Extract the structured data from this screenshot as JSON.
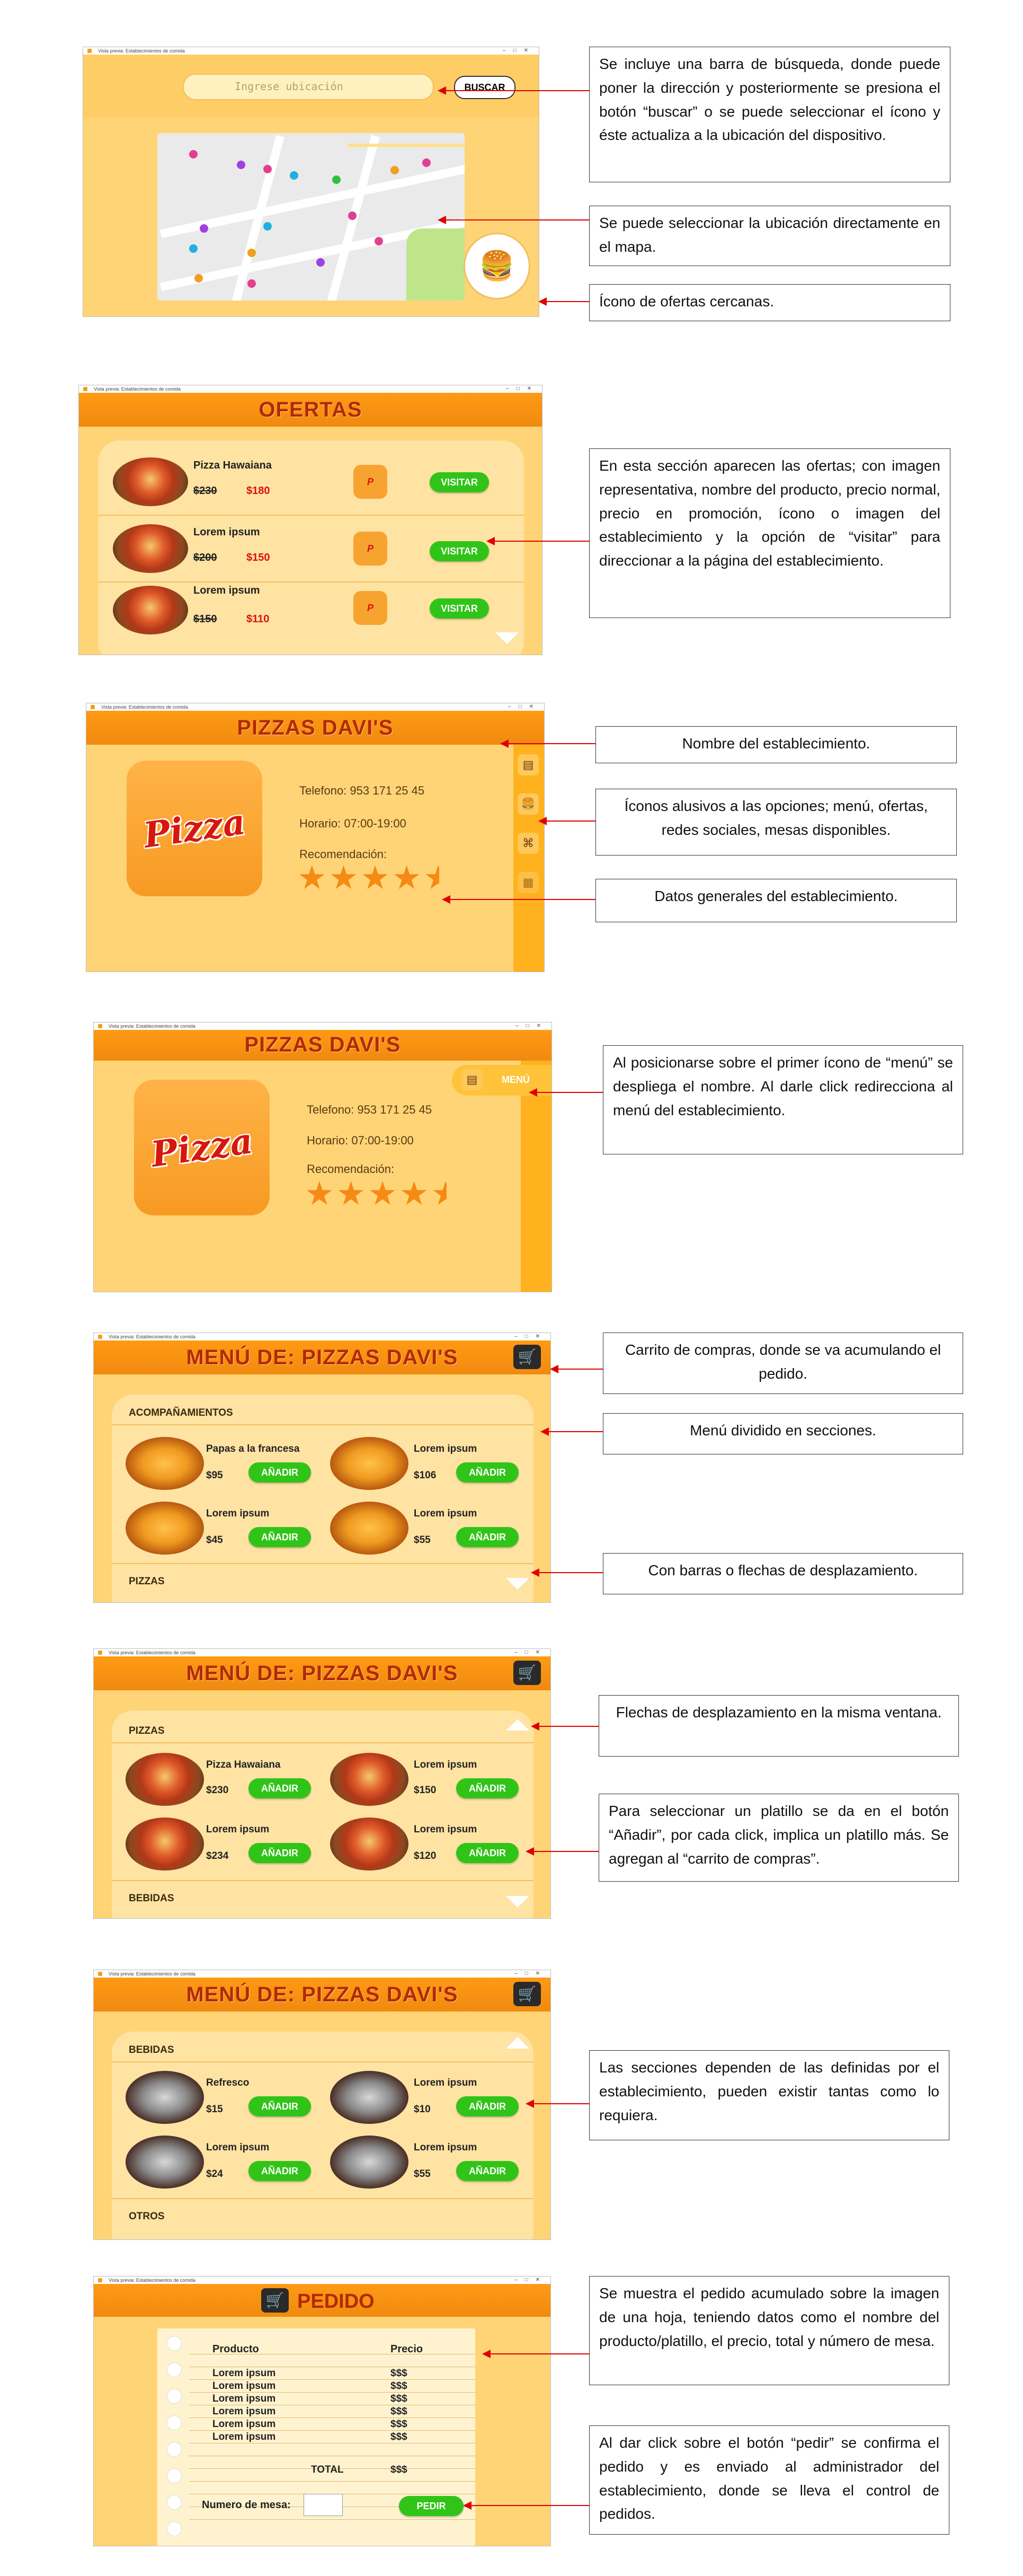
{
  "app_title": "Vista previa: Establecimientos de comida",
  "map_screen": {
    "search_placeholder": "Ingrese ubicación",
    "search_button": "BUSCAR"
  },
  "offers_screen": {
    "title": "OFERTAS",
    "items": [
      {
        "name": "Pizza Hawaiana",
        "old_price": "$230",
        "new_price": "$180",
        "button": "VISITAR"
      },
      {
        "name": "Lorem ipsum",
        "old_price": "$200",
        "new_price": "$150",
        "button": "VISITAR"
      },
      {
        "name": "Lorem ipsum",
        "old_price": "$150",
        "new_price": "$110",
        "button": "VISITAR"
      }
    ]
  },
  "establishment": {
    "name": "PIZZAS DAVI'S",
    "logo_text": "Pizza",
    "phone": "Telefono: 953 171 25 45",
    "hours": "Horario: 07:00-19:00",
    "recommendation_label": "Recomendación:",
    "rating": 4.5,
    "menu_tooltip": "MENÚ"
  },
  "menu_title": "MENÚ DE: PIZZAS DAVI'S",
  "add_label": "AÑADIR",
  "menu_screens": [
    {
      "section": "ACOMPAÑAMIENTOS",
      "next_section": "PIZZAS",
      "items": [
        {
          "name": "Papas a la francesa",
          "price": "$95"
        },
        {
          "name": "Lorem ipsum",
          "price": "$106"
        },
        {
          "name": "Lorem ipsum",
          "price": "$45"
        },
        {
          "name": "Lorem ipsum",
          "price": "$55"
        }
      ]
    },
    {
      "section": "PIZZAS",
      "next_section": "BEBIDAS",
      "items": [
        {
          "name": "Pizza Hawaiana",
          "price": "$230"
        },
        {
          "name": "Lorem ipsum",
          "price": "$150"
        },
        {
          "name": "Lorem ipsum",
          "price": "$234"
        },
        {
          "name": "Lorem ipsum",
          "price": "$120"
        }
      ]
    },
    {
      "section": "BEBIDAS",
      "next_section": "OTROS",
      "items": [
        {
          "name": "Refresco",
          "price": "$15"
        },
        {
          "name": "Lorem ipsum",
          "price": "$10"
        },
        {
          "name": "Lorem ipsum",
          "price": "$24"
        },
        {
          "name": "Lorem ipsum",
          "price": "$55"
        }
      ]
    }
  ],
  "order_screen": {
    "title": "PEDIDO",
    "col_product": "Producto",
    "col_price": "Precio",
    "rows": [
      {
        "product": "Lorem ipsum",
        "price": "$$$"
      },
      {
        "product": "Lorem ipsum",
        "price": "$$$"
      },
      {
        "product": "Lorem ipsum",
        "price": "$$$"
      },
      {
        "product": "Lorem ipsum",
        "price": "$$$"
      },
      {
        "product": "Lorem ipsum",
        "price": "$$$"
      },
      {
        "product": "Lorem ipsum",
        "price": "$$$"
      }
    ],
    "total_label": "TOTAL",
    "total_value": "$$$",
    "table_label": "Numero de mesa:",
    "order_button": "PEDIR"
  },
  "notes": {
    "n1": "Se incluye una barra de búsqueda, donde puede poner la dirección y posteriormente se presiona el botón “buscar” o se puede seleccionar el ícono y éste actualiza a la ubicación del dispositivo.",
    "n2": "Se puede seleccionar la ubicación directamente en el mapa.",
    "n3": "Ícono de ofertas cercanas.",
    "n4": "En esta sección aparecen las ofertas; con imagen representativa, nombre del producto, precio normal, precio en promoción, ícono o imagen del establecimiento y la opción de “visitar” para direccionar a la página del establecimiento.",
    "n5": "Nombre del establecimiento.",
    "n6": "Íconos alusivos a las opciones; menú, ofertas, redes sociales, mesas disponibles.",
    "n7": "Datos generales del establecimiento.",
    "n8": "Al posicionarse sobre el primer ícono de “menú” se despliega el nombre. Al darle click redirecciona al menú del establecimiento.",
    "n9": "Carrito de compras, donde se va acumulando el pedido.",
    "n10": "Menú dividido en secciones.",
    "n11": "Con barras o flechas de desplazamiento.",
    "n12": "Flechas de desplazamiento en la misma ventana.",
    "n13": "Para seleccionar un platillo se da en el botón “Añadir”, por cada click, implica un platillo más. Se agregan al “carrito de compras”.",
    "n14": "Las secciones dependen de las definidas por el establecimiento, pueden existir tantas como lo requiera.",
    "n15": "Se muestra el pedido acumulado sobre la imagen de una hoja, teniendo datos como el nombre del producto/platillo, el precio, total y número de mesa.",
    "n16": "Al dar click sobre el botón “pedir” se confirma el pedido y es enviado al administrador del establecimiento, donde se lleva el control de pedidos."
  },
  "colors": {
    "accent": "#ff9a14",
    "title_red": "#b22a06",
    "button_green": "#30c418",
    "arrow_red": "#e00000",
    "bg_yellow": "#ffd476"
  }
}
